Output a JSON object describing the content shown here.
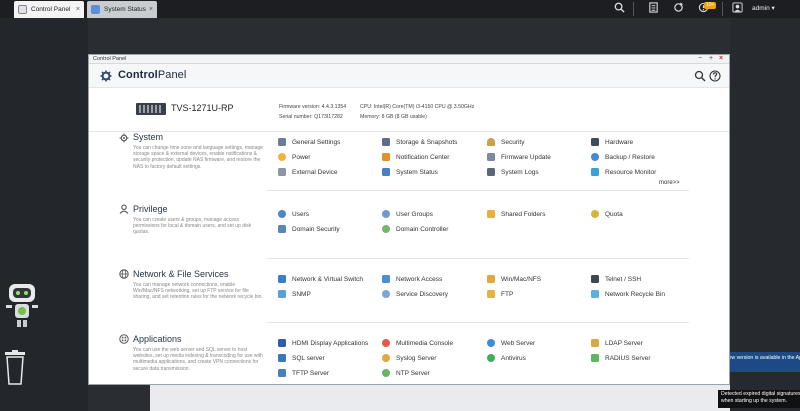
{
  "topbar": {
    "tabs": [
      {
        "label": "Control Panel"
      },
      {
        "label": "System Status"
      }
    ],
    "close_glyph": "×",
    "badge": "10+",
    "user": "admin"
  },
  "window": {
    "title": "Control Panel",
    "app_title_bold": "Control",
    "app_title_rest": "Panel",
    "controls": [
      "−",
      "+",
      "×"
    ]
  },
  "device": {
    "model": "TVS-1271U-RP",
    "firmware": "Firmware version:  4.4.3.1354",
    "serial": "Serial number:  Q173I17282",
    "cpu": "CPU:  Intel(R) Core(TM) i3-4150 CPU @ 3.50GHz",
    "memory": "Memory:  8 GB (8 GB usable)"
  },
  "sections": [
    {
      "title": "System",
      "desc": "You can change time zone and language settings, manage storage space & external devices, enable notifications & security protection, update NAS firmware, and restore the NAS to factory default settings.",
      "items": [
        "General Settings",
        "Storage & Snapshots",
        "Security",
        "Hardware",
        "Power",
        "Notification Center",
        "Firmware Update",
        "Backup / Restore",
        "External Device",
        "System Status",
        "System Logs",
        "Resource Monitor"
      ],
      "more": "more>>"
    },
    {
      "title": "Privilege",
      "desc": "You can create users & groups, manage access permissions for local & domain users, and set up disk quotas.",
      "items": [
        "Users",
        "User Groups",
        "Shared Folders",
        "Quota",
        "Domain Security",
        "Domain Controller"
      ]
    },
    {
      "title": "Network & File Services",
      "desc": "You can manage network connections, enable Win/Mac/NFS networking, set up FTP service for file sharing, and set retention rules for the network recycle bin.",
      "items": [
        "Network & Virtual Switch",
        "Network Access",
        "Win/Mac/NFS",
        "Telnet / SSH",
        "SNMP",
        "Service Discovery",
        "FTP",
        "Network Recycle Bin"
      ]
    },
    {
      "title": "Applications",
      "desc": "You can use the web server and SQL server to host websites, set up media indexing & transcoding for use with multimedia applications, and create VPN connections for secure data transmission.",
      "items": [
        "HDMI Display Applications",
        "Multimedia Console",
        "Web Server",
        "LDAP Server",
        "SQL server",
        "Syslog Server",
        "Antivirus",
        "RADIUS Server",
        "TFTP Server",
        "NTP Server"
      ]
    }
  ],
  "notifications": {
    "app_center": "A new version is available in the App Center",
    "signature_1": "Detected expired digital signatures",
    "signature_2": "when starting up the system."
  },
  "colors": {
    "accent": "#1f6fcf",
    "topbar": "#1c1e21",
    "notif": "#1d4a86"
  }
}
